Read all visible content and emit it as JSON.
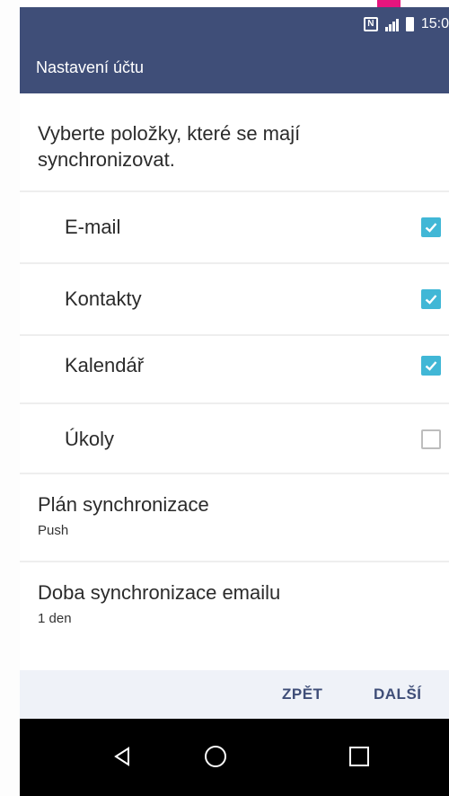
{
  "status_bar": {
    "time": "15:0",
    "nfc_icon": "nfc-icon",
    "signal_icon": "signal-icon",
    "battery_icon": "battery-icon"
  },
  "action_bar": {
    "title": "Nastavení účtu"
  },
  "intro_text": "Vyberte položky, které se mají synchronizovat.",
  "sync_items": [
    {
      "label": "E-mail",
      "checked": true
    },
    {
      "label": "Kontakty",
      "checked": true
    },
    {
      "label": "Kalendář",
      "checked": true
    },
    {
      "label": "Úkoly",
      "checked": false
    }
  ],
  "settings": [
    {
      "title": "Plán synchronizace",
      "value": "Push"
    },
    {
      "title": "Doba synchronizace emailu",
      "value": "1 den"
    }
  ],
  "footer": {
    "back_label": "ZPĚT",
    "next_label": "DALŠÍ"
  },
  "colors": {
    "header": "#3f4e78",
    "accent_checkbox": "#41b7d6",
    "footer_bg": "#eff2f8",
    "status_highlight": "#e6157e"
  }
}
